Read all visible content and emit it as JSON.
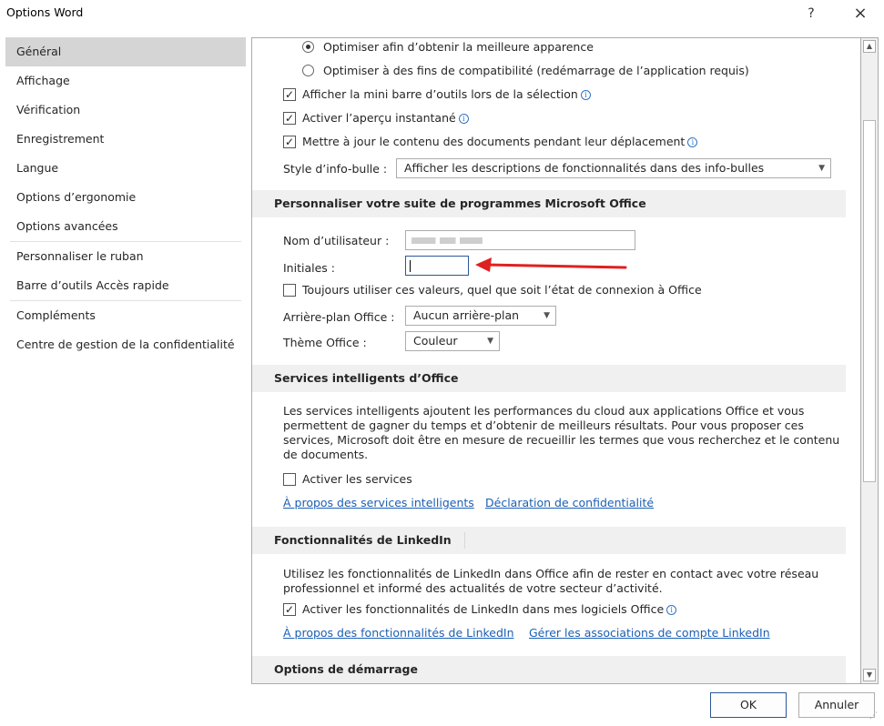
{
  "window": {
    "title": "Options Word",
    "help": "?",
    "close": "×"
  },
  "sidebar": {
    "items": [
      {
        "label": "Général"
      },
      {
        "label": "Affichage"
      },
      {
        "label": "Vérification"
      },
      {
        "label": "Enregistrement"
      },
      {
        "label": "Langue"
      },
      {
        "label": "Options d’ergonomie"
      },
      {
        "label": "Options avancées"
      },
      {
        "label": "Personnaliser le ruban"
      },
      {
        "label": "Barre d’outils Accès rapide"
      },
      {
        "label": "Compléments"
      },
      {
        "label": "Centre de gestion de la confidentialité"
      }
    ]
  },
  "general": {
    "radio_best": "Optimiser afin d’obtenir la meilleure apparence",
    "radio_compat": "Optimiser à des fins de compatibilité (redémarrage de l’application requis)",
    "cb_minitoolbar": "Afficher la mini barre d’outils lors de la sélection",
    "cb_preview": "Activer l’aperçu instantané",
    "cb_update": "Mettre à jour le contenu des documents pendant leur déplacement",
    "tooltip_label": "Style d’info-bulle :",
    "tooltip_value": "Afficher les descriptions de fonctionnalités dans des info-bulles"
  },
  "personalize": {
    "header": "Personnaliser votre suite de programmes Microsoft Office",
    "username_label": "Nom d’utilisateur :",
    "initials_label": "Initiales :",
    "initials_value": "",
    "always_use": "Toujours utiliser ces valeurs, quel que soit l’état de connexion à Office",
    "background_label": "Arrière-plan Office :",
    "background_value": "Aucun arrière-plan",
    "theme_label": "Thème Office :",
    "theme_value": "Couleur"
  },
  "smart": {
    "header": "Services intelligents d’Office",
    "description": "Les services intelligents ajoutent les performances du cloud aux applications Office et vous permettent de gagner du temps et d’obtenir de meilleurs résultats. Pour vous proposer ces services, Microsoft doit être en mesure de recueillir les termes que vous recherchez et le contenu de documents.",
    "enable": "Activer les services",
    "link_about": "À propos des services intelligents",
    "link_privacy": "Déclaration de confidentialité"
  },
  "linkedin": {
    "header": "Fonctionnalités de LinkedIn",
    "description": "Utilisez les fonctionnalités de LinkedIn dans Office afin de rester en contact avec votre réseau professionnel et informé des actualités de votre secteur d’activité.",
    "enable": "Activer les fonctionnalités de LinkedIn dans mes logiciels Office",
    "link_about": "À propos des fonctionnalités de LinkedIn",
    "link_manage": "Gérer les associations de compte LinkedIn"
  },
  "startup": {
    "header": "Options de démarrage"
  },
  "buttons": {
    "ok": "OK",
    "cancel": "Annuler"
  },
  "colors": {
    "accent": "#2b579a",
    "annotation_arrow": "#e02020",
    "link": "#1a5fb4"
  }
}
